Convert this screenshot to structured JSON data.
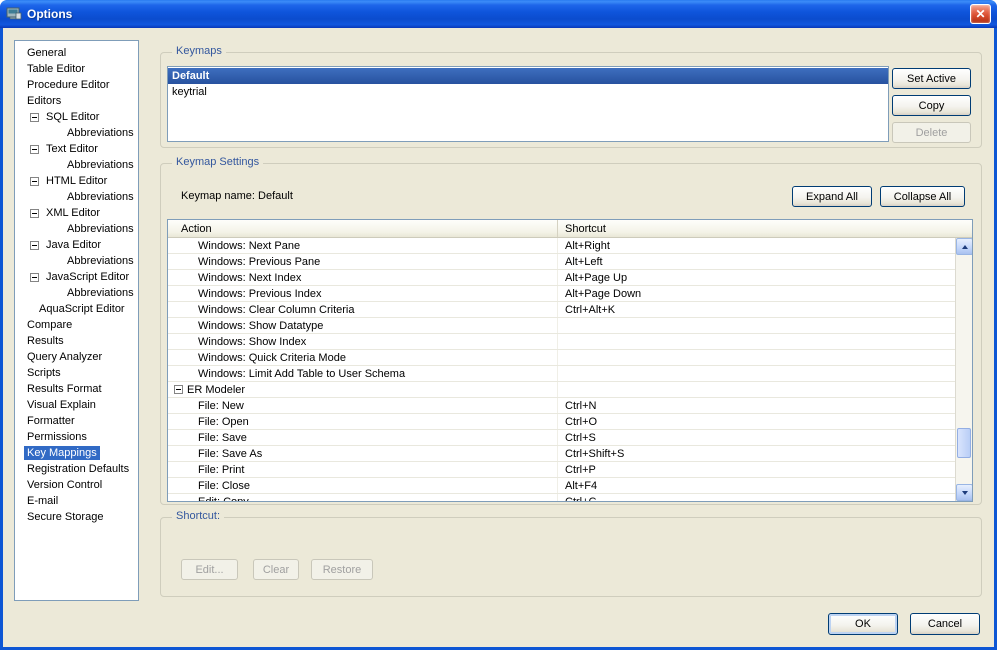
{
  "window": {
    "title": "Options"
  },
  "colors": {
    "selection": "#316AC5",
    "group_label": "#33579E",
    "titlebar_blue": "#0D56D4",
    "dialog_bg": "#ECE9D8",
    "disabled_text": "#A0A0A0"
  },
  "sidebar": {
    "items": [
      {
        "label": "General",
        "level": 0
      },
      {
        "label": "Table Editor",
        "level": 0
      },
      {
        "label": "Procedure Editor",
        "level": 0
      },
      {
        "label": "Editors",
        "level": 0
      },
      {
        "label": "SQL Editor",
        "level": 1,
        "expandable": true,
        "state": "expanded"
      },
      {
        "label": "Abbreviations",
        "level": 2
      },
      {
        "label": "Text Editor",
        "level": 1,
        "expandable": true,
        "state": "expanded"
      },
      {
        "label": "Abbreviations",
        "level": 2
      },
      {
        "label": "HTML Editor",
        "level": 1,
        "expandable": true,
        "state": "expanded"
      },
      {
        "label": "Abbreviations",
        "level": 2
      },
      {
        "label": "XML Editor",
        "level": 1,
        "expandable": true,
        "state": "expanded"
      },
      {
        "label": "Abbreviations",
        "level": 2
      },
      {
        "label": "Java Editor",
        "level": 1,
        "expandable": true,
        "state": "expanded"
      },
      {
        "label": "Abbreviations",
        "level": 2
      },
      {
        "label": "JavaScript Editor",
        "level": 1,
        "expandable": true,
        "state": "expanded"
      },
      {
        "label": "Abbreviations",
        "level": 2
      },
      {
        "label": "AquaScript Editor",
        "level": 1
      },
      {
        "label": "Compare",
        "level": 0
      },
      {
        "label": "Results",
        "level": 0
      },
      {
        "label": "Query Analyzer",
        "level": 0
      },
      {
        "label": "Scripts",
        "level": 0
      },
      {
        "label": "Results Format",
        "level": 0
      },
      {
        "label": "Visual Explain",
        "level": 0
      },
      {
        "label": "Formatter",
        "level": 0
      },
      {
        "label": "Permissions",
        "level": 0
      },
      {
        "label": "Key Mappings",
        "level": 0,
        "selected": true
      },
      {
        "label": "Registration Defaults",
        "level": 0
      },
      {
        "label": "Version Control",
        "level": 0
      },
      {
        "label": "E-mail",
        "level": 0
      },
      {
        "label": "Secure Storage",
        "level": 0
      }
    ]
  },
  "keymaps": {
    "group_title": "Keymaps",
    "list": [
      {
        "label": "Default",
        "selected": true
      },
      {
        "label": "keytrial",
        "selected": false
      }
    ],
    "buttons": [
      {
        "label": "Set Active",
        "enabled": true
      },
      {
        "label": "Copy",
        "enabled": true
      },
      {
        "label": "Delete",
        "enabled": false
      }
    ]
  },
  "keymap_settings": {
    "group_title": "Keymap Settings",
    "keymap_name": "Keymap name: Default",
    "expand_all_label": "Expand All",
    "collapse_all_label": "Collapse All",
    "table": {
      "columns": [
        "Action",
        "Shortcut"
      ],
      "rows": [
        {
          "action": "Windows: Next Pane",
          "shortcut": "Alt+Right",
          "indent": 1
        },
        {
          "action": "Windows: Previous Pane",
          "shortcut": "Alt+Left",
          "indent": 1
        },
        {
          "action": "Windows: Next Index",
          "shortcut": "Alt+Page Up",
          "indent": 1
        },
        {
          "action": "Windows: Previous Index",
          "shortcut": "Alt+Page Down",
          "indent": 1
        },
        {
          "action": "Windows: Clear Column Criteria",
          "shortcut": "Ctrl+Alt+K",
          "indent": 1
        },
        {
          "action": "Windows: Show Datatype",
          "shortcut": "",
          "indent": 1
        },
        {
          "action": "Windows: Show Index",
          "shortcut": "",
          "indent": 1
        },
        {
          "action": "Windows: Quick Criteria Mode",
          "shortcut": "",
          "indent": 1
        },
        {
          "action": "Windows: Limit Add Table to User Schema",
          "shortcut": "",
          "indent": 1
        },
        {
          "action": "ER Modeler",
          "shortcut": "",
          "group": true,
          "state": "expanded"
        },
        {
          "action": "File: New",
          "shortcut": "Ctrl+N",
          "indent": 1
        },
        {
          "action": "File: Open",
          "shortcut": "Ctrl+O",
          "indent": 1
        },
        {
          "action": "File: Save",
          "shortcut": "Ctrl+S",
          "indent": 1
        },
        {
          "action": "File: Save As",
          "shortcut": "Ctrl+Shift+S",
          "indent": 1
        },
        {
          "action": "File: Print",
          "shortcut": "Ctrl+P",
          "indent": 1
        },
        {
          "action": "File: Close",
          "shortcut": "Alt+F4",
          "indent": 1
        },
        {
          "action": "Edit: Copy",
          "shortcut": "Ctrl+C",
          "indent": 1
        }
      ]
    },
    "scrollbar": {
      "orientation": "vertical",
      "thumb_position": 0.72
    }
  },
  "shortcut": {
    "group_title": "Shortcut:",
    "buttons": [
      {
        "label": "Edit...",
        "enabled": false
      },
      {
        "label": "Clear",
        "enabled": false
      },
      {
        "label": "Restore",
        "enabled": false
      }
    ]
  },
  "footer": {
    "ok_label": "OK",
    "cancel_label": "Cancel"
  }
}
